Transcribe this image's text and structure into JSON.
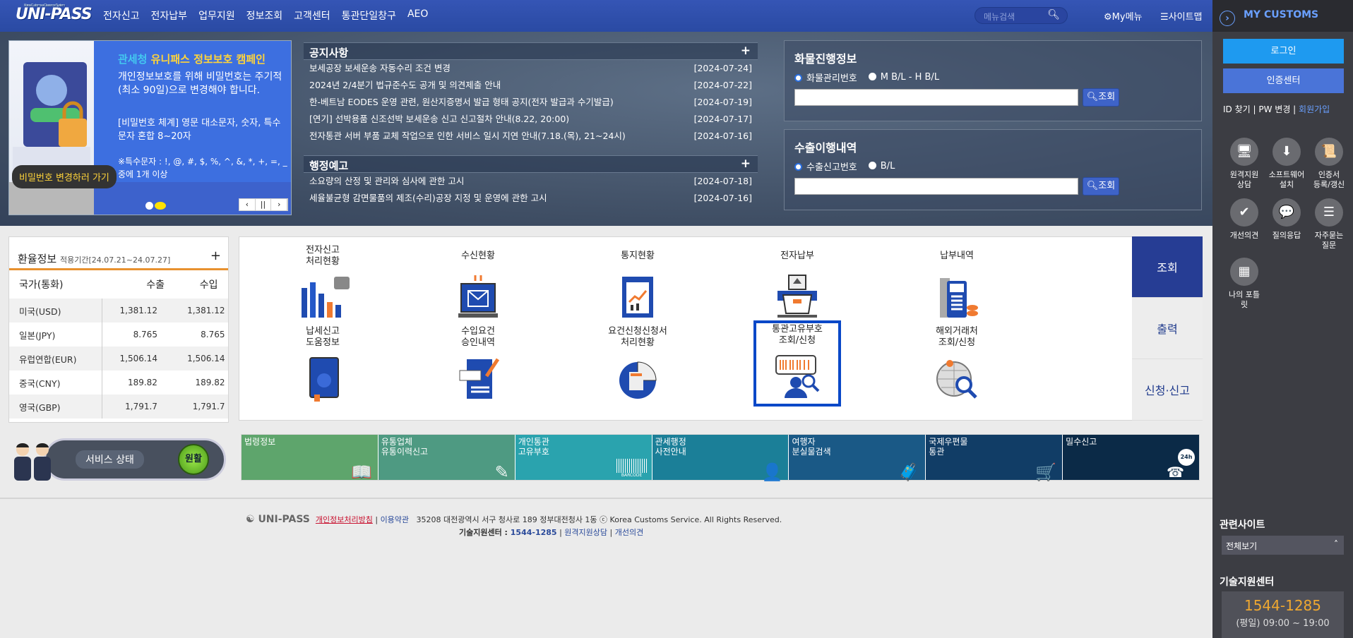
{
  "header": {
    "logo": "UNI-PASS",
    "logo_sub": "Korea Customs e-Clearance System",
    "nav": [
      "전자신고",
      "전자납부",
      "업무지원",
      "정보조회",
      "고객센터",
      "통관단일창구",
      "AEO"
    ],
    "search_placeholder": "메뉴검색",
    "mymenu": "My메뉴",
    "sitemap": "사이트맵"
  },
  "banner": {
    "title_a": "관세청",
    "title_b": "유니패스 정보보호 캠페인",
    "text1": "개인정보보호를 위해 비밀번호는 주기적(최소 90일)으로 변경해야 합니다.",
    "text2": "[비밀번호 체계] 영문 대소문자, 숫자, 특수문자 혼합 8~20자",
    "text3": "※특수문자 : !, @, #, $, %, ^, &, *, +, =, _ 중에 1개 이상",
    "button": "비밀번호 변경하러 가기",
    "ctrl_prev": "‹",
    "ctrl_pause": "||",
    "ctrl_next": "›"
  },
  "notice": {
    "title": "공지사항",
    "items": [
      {
        "t": "보세공장 보세운송 자동수리 조건 변경",
        "d": "[2024-07-24]"
      },
      {
        "t": "2024년 2/4분기 법규준수도 공개 및 의견제출 안내",
        "d": "[2024-07-22]"
      },
      {
        "t": "한-베트남 EODES 운영 관련, 원산지증명서 발급 형태 공지(전자 발급과 수기발급)",
        "d": "[2024-07-19]"
      },
      {
        "t": "[연기] 선박용품 신조선박 보세운송 신고 신고절차 안내(8.22, 20:00)",
        "d": "[2024-07-17]"
      },
      {
        "t": "전자통관 서버 부품 교체 작업으로 인한 서비스 일시 지연 안내(7.18.(목), 21~24시)",
        "d": "[2024-07-16]"
      }
    ]
  },
  "admin": {
    "title": "행정예고",
    "items": [
      {
        "t": "소요량의 산정 및 관리와 심사에 관한 고시",
        "d": "[2024-07-18]"
      },
      {
        "t": "세율불균형 감면물품의 제조(수리)공장 지정 및 운영에 관한 고시",
        "d": "[2024-07-16]"
      }
    ]
  },
  "cargo": {
    "title": "화물진행정보",
    "opt1": "화물관리번호",
    "opt2": "M B/L - H B/L",
    "value": "",
    "button": "조회"
  },
  "export": {
    "title": "수출이행내역",
    "opt1": "수출신고번호",
    "opt2": "B/L",
    "value": "",
    "button": "조회"
  },
  "exchange": {
    "title": "환율정보",
    "period": "적용기간[24.07.21~24.07.27]",
    "headers": [
      "국가(통화)",
      "수출",
      "수입"
    ],
    "rows": [
      [
        "미국(USD)",
        "1,381.12",
        "1,381.12"
      ],
      [
        "일본(JPY)",
        "8.765",
        "8.765"
      ],
      [
        "유럽연합(EUR)",
        "1,506.14",
        "1,506.14"
      ],
      [
        "중국(CNY)",
        "189.82",
        "189.82"
      ],
      [
        "영국(GBP)",
        "1,791.7",
        "1,791.7"
      ]
    ]
  },
  "service": {
    "label": "서비스 상태",
    "status": "원활"
  },
  "menu": {
    "items": [
      "전자신고\n처리현황",
      "수신현황",
      "통지현황",
      "전자납부",
      "납부내역",
      "납세신고\n도움정보",
      "수입요건\n승인내역",
      "요건신청신청서\n처리현황",
      "통관고유부호\n조회/신청",
      "해외거래처\n조회/신청"
    ],
    "tabs": [
      "조회",
      "출력",
      "신청·신고"
    ],
    "active_tab": "조회",
    "selected_item": "통관고유부호\n조회/신청"
  },
  "tiles": [
    {
      "label": "법령정보",
      "color": "#5ea56c"
    },
    {
      "label": "유통업체\n유통이력신고",
      "color": "#4e9a82"
    },
    {
      "label": "개인통관\n고유부호",
      "color": "#2aa3ae"
    },
    {
      "label": "관세행정\n사전안내",
      "color": "#1b7f98"
    },
    {
      "label": "여행자\n분실물검색",
      "color": "#1a5986"
    },
    {
      "label": "국제우편물\n통관",
      "color": "#113d66"
    },
    {
      "label": "밀수신고",
      "color": "#0b2a47"
    }
  ],
  "tile_icons": {
    "barcode": "BARCODE",
    "phone": "24h"
  },
  "footer": {
    "logo": "UNI-PASS",
    "privacy": "개인정보처리방침",
    "terms": "이용약관",
    "address": "35208 대전광역시 서구 청사로 189 정부대전청사 1동 ⓒ Korea Customs Service. All Rights Reserved.",
    "support_label": "기술지원센터 : ",
    "support_phone": "1544-1285",
    "remote": "원격지원상담",
    "feedback": "개선의견"
  },
  "sidebar": {
    "title": "MY CUSTOMS",
    "login": "로그인",
    "cert": "인증센터",
    "id_find": "ID 찾기",
    "pw_change": "PW 변경",
    "join": "회원가입",
    "icons": [
      "원격지원\n상담",
      "소프트웨어\n설치",
      "인증서\n등록/갱신",
      "개선의견",
      "질의응답",
      "자주묻는\n질문",
      "나의 포틀\n릿"
    ],
    "related_title": "관련사이트",
    "related_value": "전체보기",
    "support_title": "기술지원센터",
    "support_phone": "1544-1285",
    "support_hours": "(평일) 09:00 ~ 19:00"
  }
}
